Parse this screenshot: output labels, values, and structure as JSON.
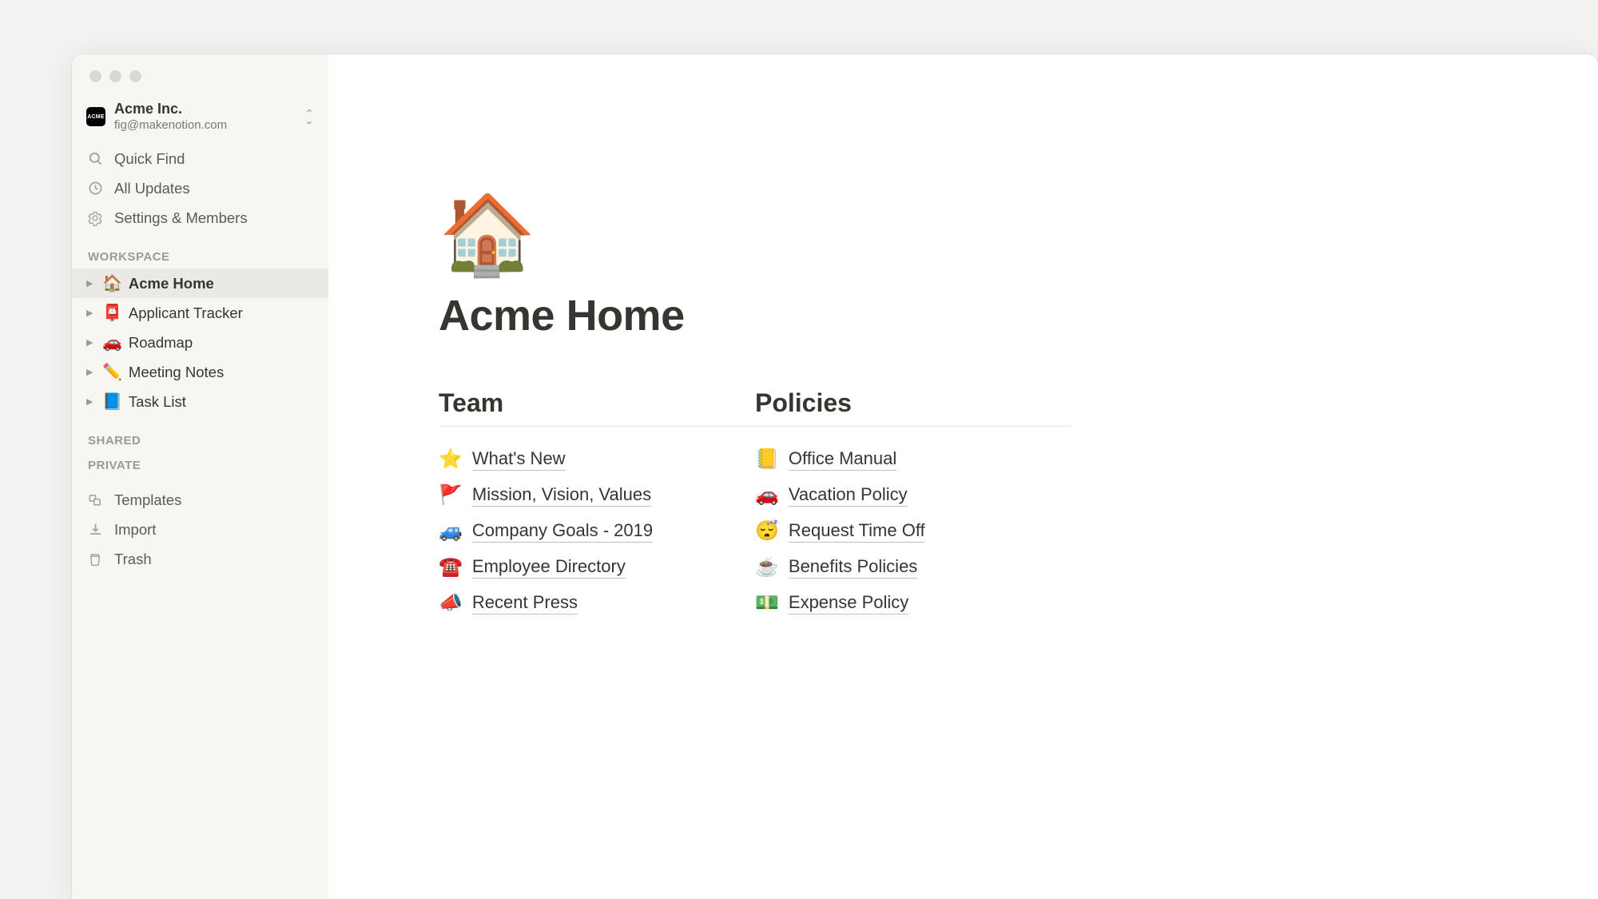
{
  "workspace": {
    "logo_text": "ACME",
    "name": "Acme Inc.",
    "email": "fig@makenotion.com"
  },
  "sidebar": {
    "quick_find": "Quick Find",
    "all_updates": "All Updates",
    "settings": "Settings & Members",
    "sections": {
      "workspace": "WORKSPACE",
      "shared": "SHARED",
      "private": "PRIVATE"
    },
    "pages": [
      {
        "emoji": "🏠",
        "label": "Acme Home",
        "active": true
      },
      {
        "emoji": "📮",
        "label": "Applicant Tracker",
        "active": false
      },
      {
        "emoji": "🚗",
        "label": "Roadmap",
        "active": false
      },
      {
        "emoji": "✏️",
        "label": "Meeting Notes",
        "active": false
      },
      {
        "emoji": "📘",
        "label": "Task List",
        "active": false
      }
    ],
    "templates": "Templates",
    "import": "Import",
    "trash": "Trash"
  },
  "page": {
    "emoji": "🏠",
    "title": "Acme Home",
    "columns": [
      {
        "heading": "Team",
        "links": [
          {
            "emoji": "⭐",
            "label": "What's New"
          },
          {
            "emoji": "🚩",
            "label": "Mission, Vision, Values"
          },
          {
            "emoji": "🚙",
            "label": "Company Goals - 2019"
          },
          {
            "emoji": "☎️",
            "label": "Employee Directory"
          },
          {
            "emoji": "📣",
            "label": "Recent Press"
          }
        ]
      },
      {
        "heading": "Policies",
        "links": [
          {
            "emoji": "📒",
            "label": "Office Manual"
          },
          {
            "emoji": "🚗",
            "label": "Vacation Policy"
          },
          {
            "emoji": "😴",
            "label": "Request Time Off"
          },
          {
            "emoji": "☕",
            "label": "Benefits Policies"
          },
          {
            "emoji": "💵",
            "label": "Expense Policy"
          }
        ]
      }
    ]
  }
}
